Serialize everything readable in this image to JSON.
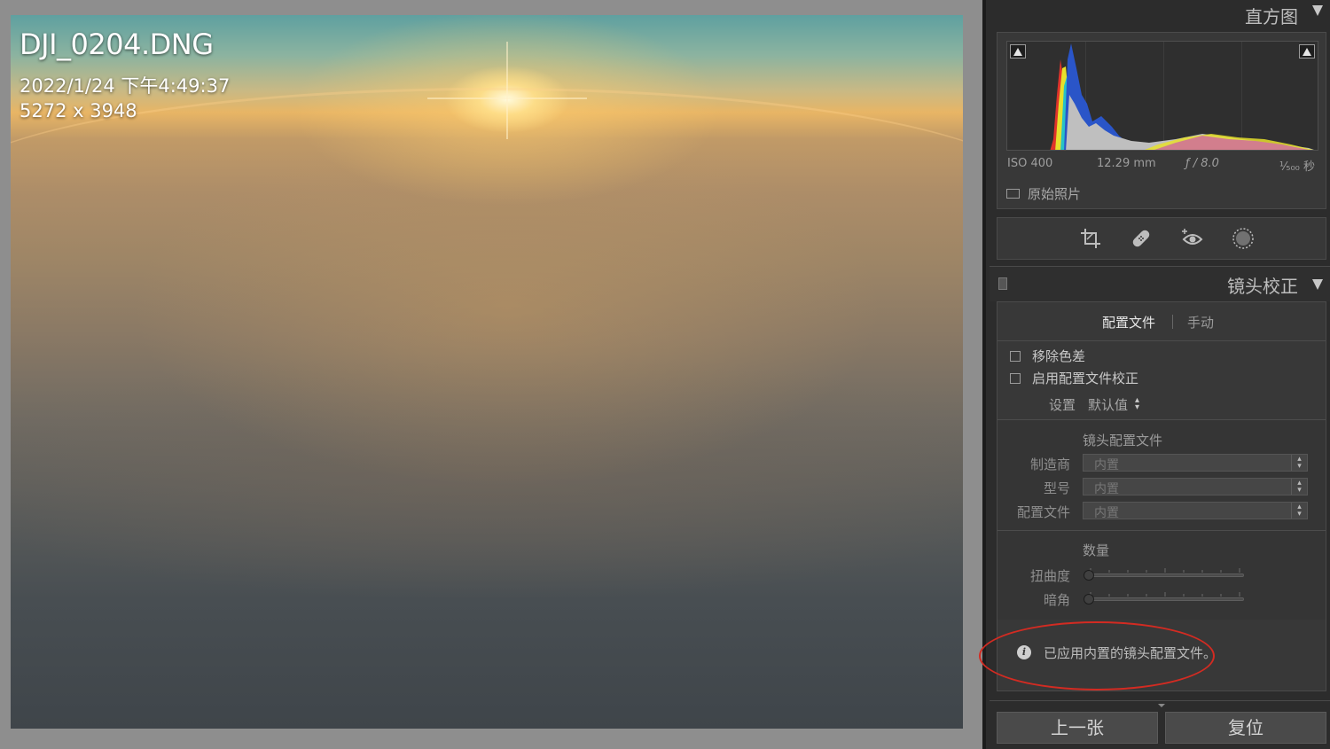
{
  "photo": {
    "filename": "DJI_0204.DNG",
    "datetime": "2022/1/24 下午4:49:37",
    "dimensions": "5272 x 3948"
  },
  "histogram": {
    "title": "直方图",
    "exif": {
      "iso": "ISO 400",
      "focal_length": "12.29 mm",
      "aperture": "ƒ / 8.0",
      "shutter": "¹⁄₅₀₀ 秒"
    },
    "original_photo_label": "原始照片"
  },
  "tools": [
    "crop-icon",
    "healing-icon",
    "redeye-icon",
    "mask-icon"
  ],
  "lens_correction": {
    "title": "镜头校正",
    "tabs": [
      "配置文件",
      "手动"
    ],
    "active_tab": "配置文件",
    "remove_ca_label": "移除色差",
    "enable_profile_label": "启用配置文件校正",
    "setup_label": "设置",
    "setup_value": "默认值",
    "lens_profile_heading": "镜头配置文件",
    "make_label": "制造商",
    "make_value": "内置",
    "model_label": "型号",
    "model_value": "内置",
    "profile_label": "配置文件",
    "profile_value": "内置",
    "amount_heading": "数量",
    "distortion_label": "扭曲度",
    "vignetting_label": "暗角",
    "info_message": "已应用内置的镜头配置文件。"
  },
  "buttons": {
    "previous": "上一张",
    "reset": "复位"
  },
  "colors": {
    "panel_bg": "#2c2c2c",
    "section_bg": "#383838",
    "highlight": "#d32b22"
  }
}
